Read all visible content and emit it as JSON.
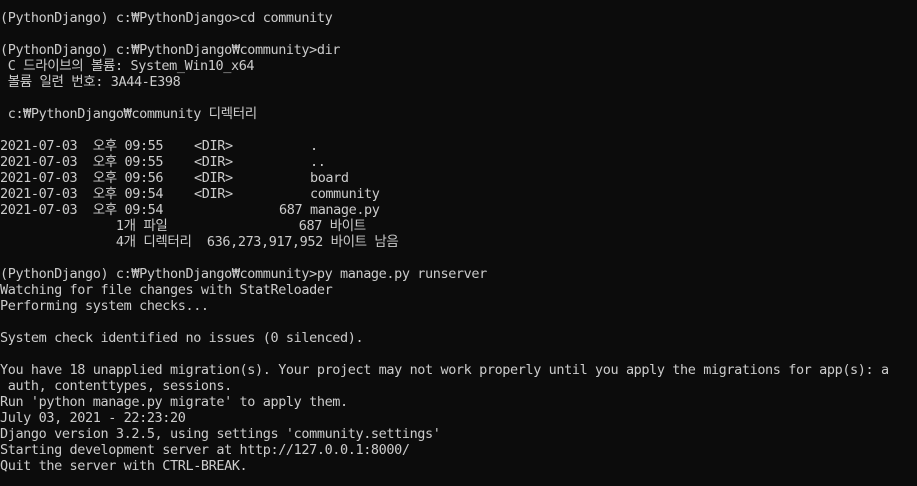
{
  "terminal": {
    "colors": {
      "background": "#0c0c0c",
      "foreground": "#cccccc"
    },
    "lines": [
      "(PythonDjango) c:₩PythonDjango>cd community",
      "",
      "(PythonDjango) c:₩PythonDjango₩community>dir",
      " C 드라이브의 볼륨: System_Win10_x64",
      " 볼륨 일련 번호: 3A44-E398",
      "",
      " c:₩PythonDjango₩community 디렉터리",
      "",
      "2021-07-03  오후 09:55    <DIR>          .",
      "2021-07-03  오후 09:55    <DIR>          ..",
      "2021-07-03  오후 09:56    <DIR>          board",
      "2021-07-03  오후 09:54    <DIR>          community",
      "2021-07-03  오후 09:54               687 manage.py",
      "               1개 파일                 687 바이트",
      "               4개 디렉터리  636,273,917,952 바이트 남음",
      "",
      "(PythonDjango) c:₩PythonDjango₩community>py manage.py runserver",
      "Watching for file changes with StatReloader",
      "Performing system checks...",
      "",
      "System check identified no issues (0 silenced).",
      "",
      "You have 18 unapplied migration(s). Your project may not work properly until you apply the migrations for app(s): a",
      " auth, contenttypes, sessions.",
      "Run 'python manage.py migrate' to apply them.",
      "July 03, 2021 - 22:23:20",
      "Django version 3.2.5, using settings 'community.settings'",
      "Starting development server at http://127.0.0.1:8000/",
      "Quit the server with CTRL-BREAK."
    ]
  }
}
